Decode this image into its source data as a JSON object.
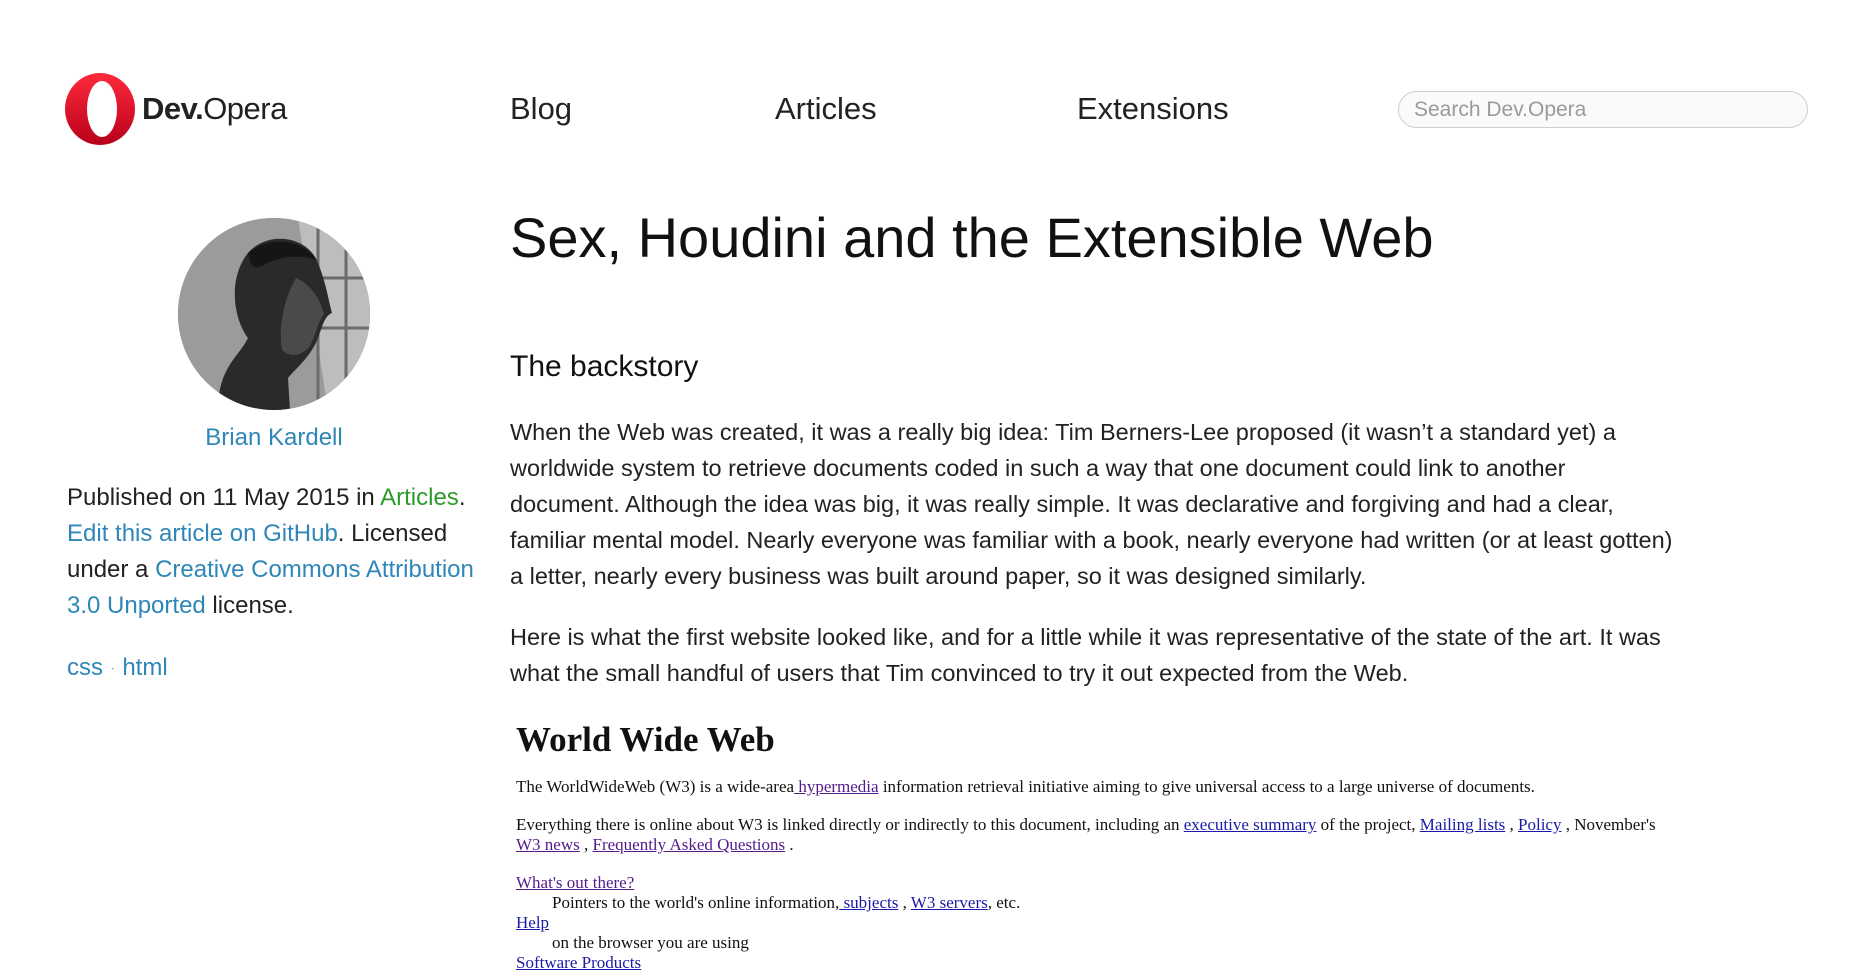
{
  "header": {
    "logo": {
      "bold": "Dev.",
      "rest": "Opera"
    },
    "nav": [
      {
        "label": "Blog"
      },
      {
        "label": "Articles"
      },
      {
        "label": "Extensions"
      }
    ],
    "search": {
      "placeholder": "Search Dev.Opera",
      "value": ""
    }
  },
  "sidebar": {
    "author": "Brian Kardell",
    "meta": {
      "published_prefix": "Published on 11 May 2015 in ",
      "category": "Articles",
      "period": ".",
      "edit_link": "Edit this article on GitHub",
      "licensed_text": ". Licensed under a ",
      "license_link": "Creative Commons Attribution 3.0 Unported",
      "license_suffix": " license."
    },
    "tags": [
      "css",
      "html"
    ],
    "tag_separator": "·"
  },
  "article": {
    "title": "Sex, Houdini and the Extensible Web",
    "section_heading": "The backstory",
    "paragraphs": [
      "When the Web was created, it was a really big idea: Tim Berners-Lee proposed (it wasn’t a standard yet) a worldwide system to retrieve documents coded in such a way that one document could link to another document. Although the idea was big, it was really simple. It was declarative and forgiving and had a clear, familiar mental model. Nearly everyone was familiar with a book, nearly everyone had written (or at least gotten) a letter, nearly every business was built around paper, so it was designed similarly.",
      "Here is what the first website looked like, and for a little while it was representative of the state of the art. It was what the small handful of users that Tim convinced to try it out expected from the Web."
    ]
  },
  "first_website": {
    "heading": "World Wide Web",
    "intro_before": "The WorldWideWeb (W3) is a wide-area",
    "intro_link": " hypermedia",
    "intro_after": " information retrieval initiative aiming to give universal access to a large universe of documents.",
    "line2_before": "Everything there is online about W3 is linked directly or indirectly to this document, including an ",
    "line2_link1": "executive summary",
    "line2_mid": " of the project, ",
    "line2_link2": "Mailing lists",
    "line2_sep1": " , ",
    "line2_link3": "Policy",
    "line2_sep2": " , November's ",
    "line2_link4": "W3 news",
    "line2_sep3": " , ",
    "line2_link5": "Frequently Asked Questions",
    "line2_end": " .",
    "whats_out_there": "What's out there?",
    "pointers_text": "Pointers to the world's online information,",
    "subjects_link": " subjects",
    "comma_sep": " , ",
    "w3servers_link": "W3 servers",
    "etc": ", etc.",
    "help_link": "Help",
    "help_text": "on the browser you are using",
    "software_link": "Software Products"
  },
  "colors": {
    "link_blue": "#2f86b8",
    "category_green": "#2d9a2d",
    "opera_red": "#e0112b"
  }
}
